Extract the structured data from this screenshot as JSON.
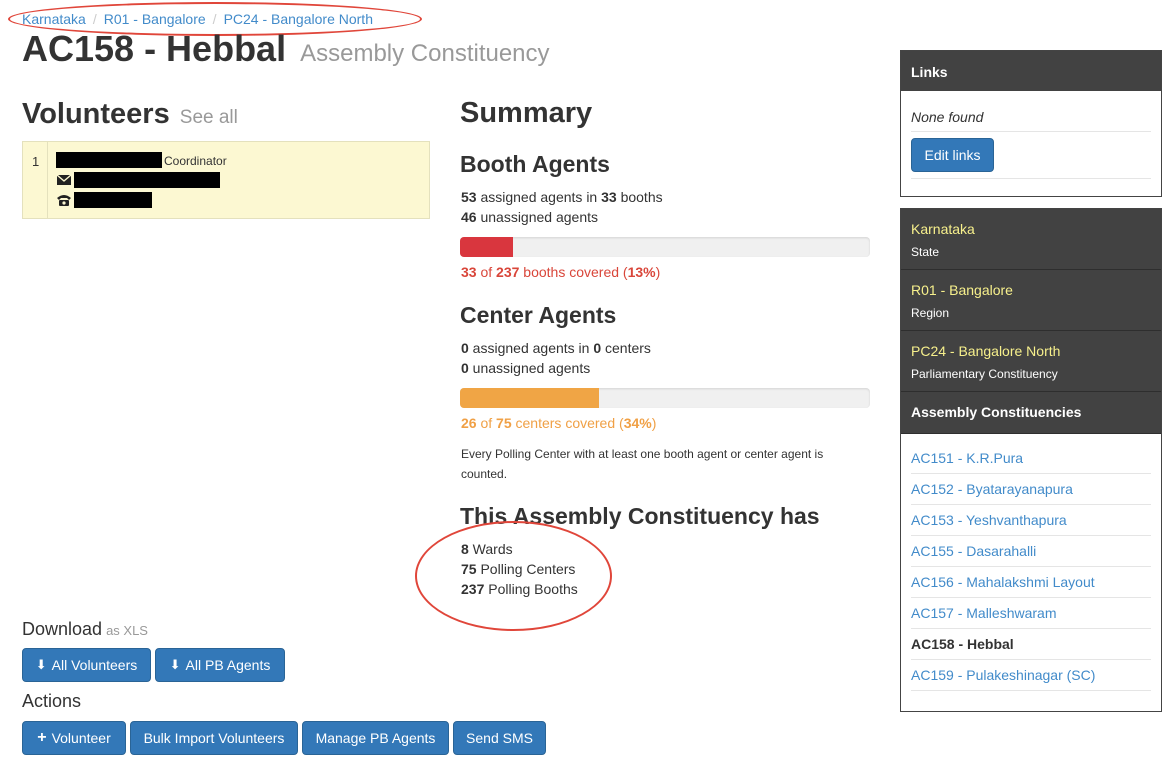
{
  "breadcrumb": [
    "Karnataka",
    "R01 - Bangalore",
    "PC24 - Bangalore North"
  ],
  "page": {
    "title": "AC158 - Hebbal",
    "subtitle": "Assembly Constituency"
  },
  "volunteers": {
    "heading": "Volunteers",
    "see_all": "See all",
    "rows": [
      {
        "index": "1",
        "role": "Coordinator"
      }
    ]
  },
  "summary": {
    "heading": "Summary",
    "booth_agents": {
      "heading": "Booth Agents",
      "assigned_count": "53",
      "assigned_text": " assigned agents in ",
      "booths_count": "33",
      "booths_text": " booths",
      "unassigned_count": "46",
      "unassigned_text": " unassigned agents",
      "covered": "33",
      "of_text": " of ",
      "total": "237",
      "covered_text": " booths covered (",
      "percent": "13%",
      "close": ")",
      "progress": 0.13,
      "bar_color": "#d9363e"
    },
    "center_agents": {
      "heading": "Center Agents",
      "assigned_count": "0",
      "assigned_text": " assigned agents in ",
      "centers_count": "0",
      "centers_text": " centers",
      "unassigned_count": "0",
      "unassigned_text": " unassigned agents",
      "covered": "26",
      "of_text": " of ",
      "total": "75",
      "covered_text": " centers covered (",
      "percent": "34%",
      "close": ")",
      "progress": 0.34,
      "bar_color": "#f0a545",
      "note_line1": "Every Polling Center with at least one booth agent or center agent is",
      "note_line2": "counted."
    },
    "has": {
      "heading": "This Assembly Constituency has",
      "wards_count": "8",
      "wards_label": " Wards",
      "centers_count": "75",
      "centers_label": " Polling Centers",
      "booths_count": "237",
      "booths_label": " Polling Booths"
    }
  },
  "download": {
    "heading": "Download",
    "format": "as XLS",
    "all_volunteers": "All Volunteers",
    "all_pb_agents": "All PB Agents"
  },
  "actions": {
    "heading": "Actions",
    "volunteer": "Volunteer",
    "bulk_import": "Bulk Import Volunteers",
    "manage_pb": "Manage PB Agents",
    "send_sms": "Send SMS"
  },
  "links": {
    "heading": "Links",
    "empty": "None found",
    "edit": "Edit links"
  },
  "nav": {
    "state": {
      "name": "Karnataka",
      "type": "State"
    },
    "region": {
      "name": "R01 - Bangalore",
      "type": "Region"
    },
    "pc": {
      "name": "PC24 - Bangalore North",
      "type": "Parliamentary Constituency"
    },
    "assembly_heading": "Assembly Constituencies",
    "constituencies": [
      "AC151 - K.R.Pura",
      "AC152 - Byatarayanapura",
      "AC153 - Yeshvanthapura",
      "AC155 - Dasarahalli",
      "AC156 - Mahalakshmi Layout",
      "AC157 - Malleshwaram",
      "AC158 - Hebbal",
      "AC159 - Pulakeshinagar (SC)"
    ],
    "active_index": 6
  },
  "colors": {
    "link": "#428bca",
    "button": "#3378b8",
    "annotation": "#e0463a",
    "panel_dark": "#424242",
    "panel_highlight": "#f7f08c"
  }
}
